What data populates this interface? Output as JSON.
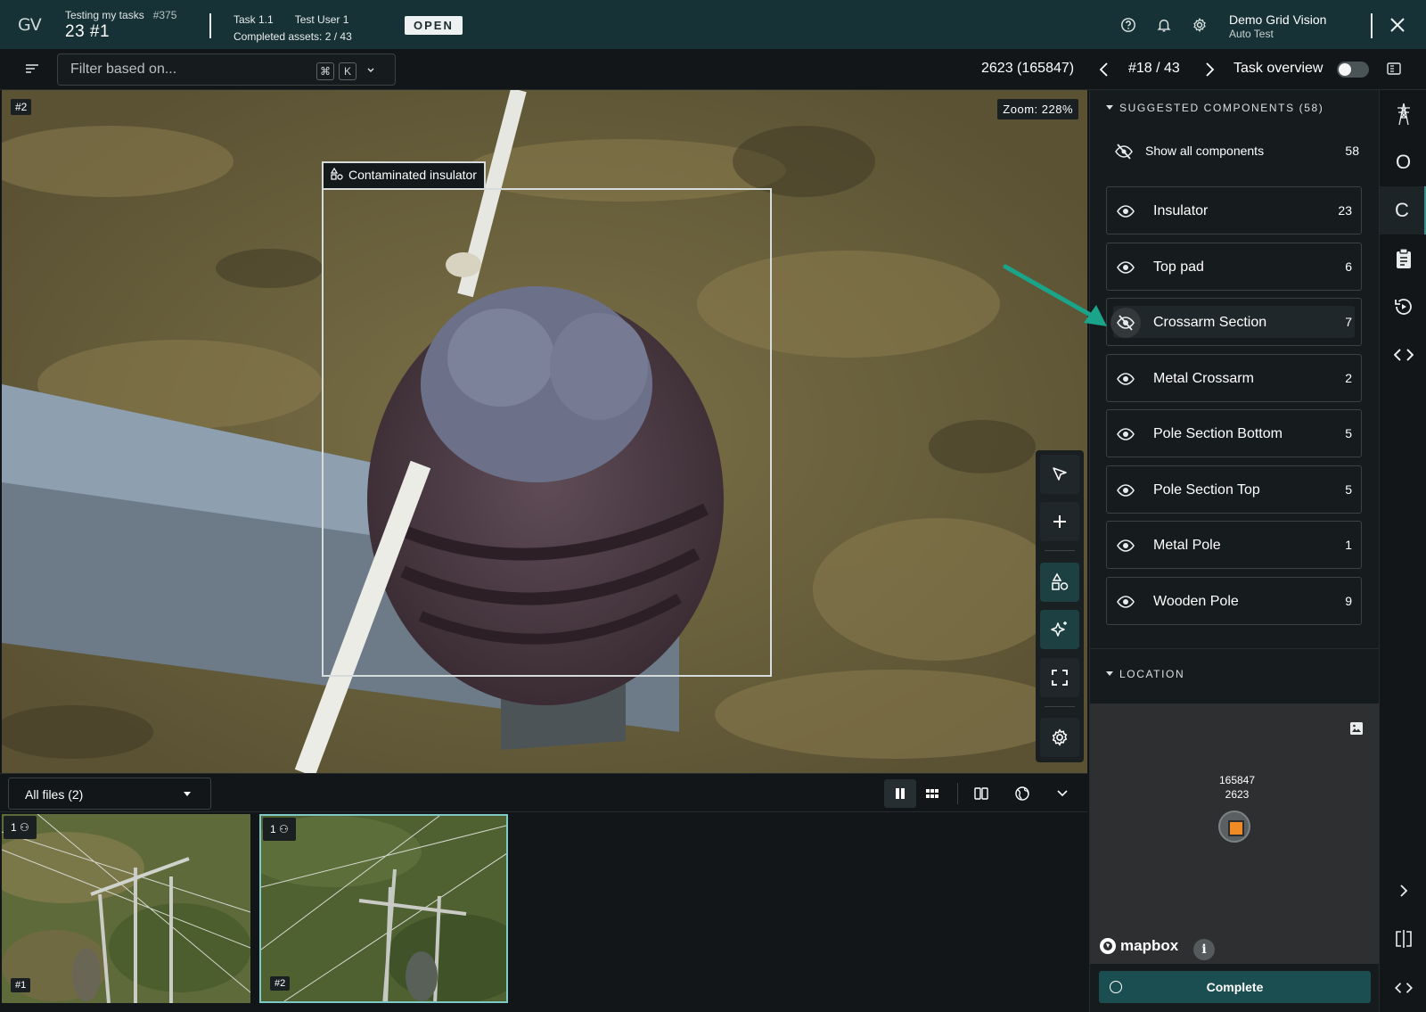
{
  "topbar": {
    "logo": "GV",
    "project_name": "Testing my tasks",
    "project_id": "#375",
    "asset_title": "23 #1",
    "task_name": "Task 1.1",
    "assignee": "Test User 1",
    "completed_assets": "Completed assets: 2 / 43",
    "status": "OPEN",
    "org_name": "Demo Grid Vision",
    "org_role": "Auto Test"
  },
  "toolbar": {
    "filter_placeholder": "Filter based on...",
    "kbd_cmd": "⌘",
    "kbd_k": "K",
    "asset_ref": "2623 (165847)",
    "position": "#18 / 43",
    "task_overview_label": "Task overview",
    "task_overview_enabled": false
  },
  "viewer": {
    "image_tag": "#2",
    "zoom": "Zoom: 228%",
    "annotation_label": "Contaminated insulator"
  },
  "files": {
    "selector_label": "All files (2)",
    "thumbnails": [
      {
        "count": "1",
        "tag": "#1",
        "selected": false
      },
      {
        "count": "1",
        "tag": "#2",
        "selected": true
      }
    ]
  },
  "components": {
    "header": "SUGGESTED COMPONENTS (58)",
    "show_all_label": "Show all components",
    "show_all_count": "58",
    "items": [
      {
        "label": "Insulator",
        "count": "23",
        "visible": true
      },
      {
        "label": "Top pad",
        "count": "6",
        "visible": true
      },
      {
        "label": "Crossarm Section",
        "count": "7",
        "visible": false
      },
      {
        "label": "Metal Crossarm",
        "count": "2",
        "visible": true
      },
      {
        "label": "Pole Section Bottom",
        "count": "5",
        "visible": true
      },
      {
        "label": "Pole Section Top",
        "count": "5",
        "visible": true
      },
      {
        "label": "Metal Pole",
        "count": "1",
        "visible": true
      },
      {
        "label": "Wooden Pole",
        "count": "9",
        "visible": true
      }
    ]
  },
  "location": {
    "header": "LOCATION",
    "pin_id": "165847",
    "pin_ref": "2623",
    "attribution": "mapbox",
    "info": "i"
  },
  "actions": {
    "complete_label": "Complete"
  },
  "rail": {
    "items": [
      "tower-icon",
      "O",
      "C",
      "clipboard-icon",
      "history-icon",
      "code-icon"
    ]
  },
  "colors": {
    "topbar_bg": "#173236",
    "accent_teal": "#1b4e50",
    "pin_orange": "#f08a24",
    "arrow_teal": "#1aa58a"
  }
}
